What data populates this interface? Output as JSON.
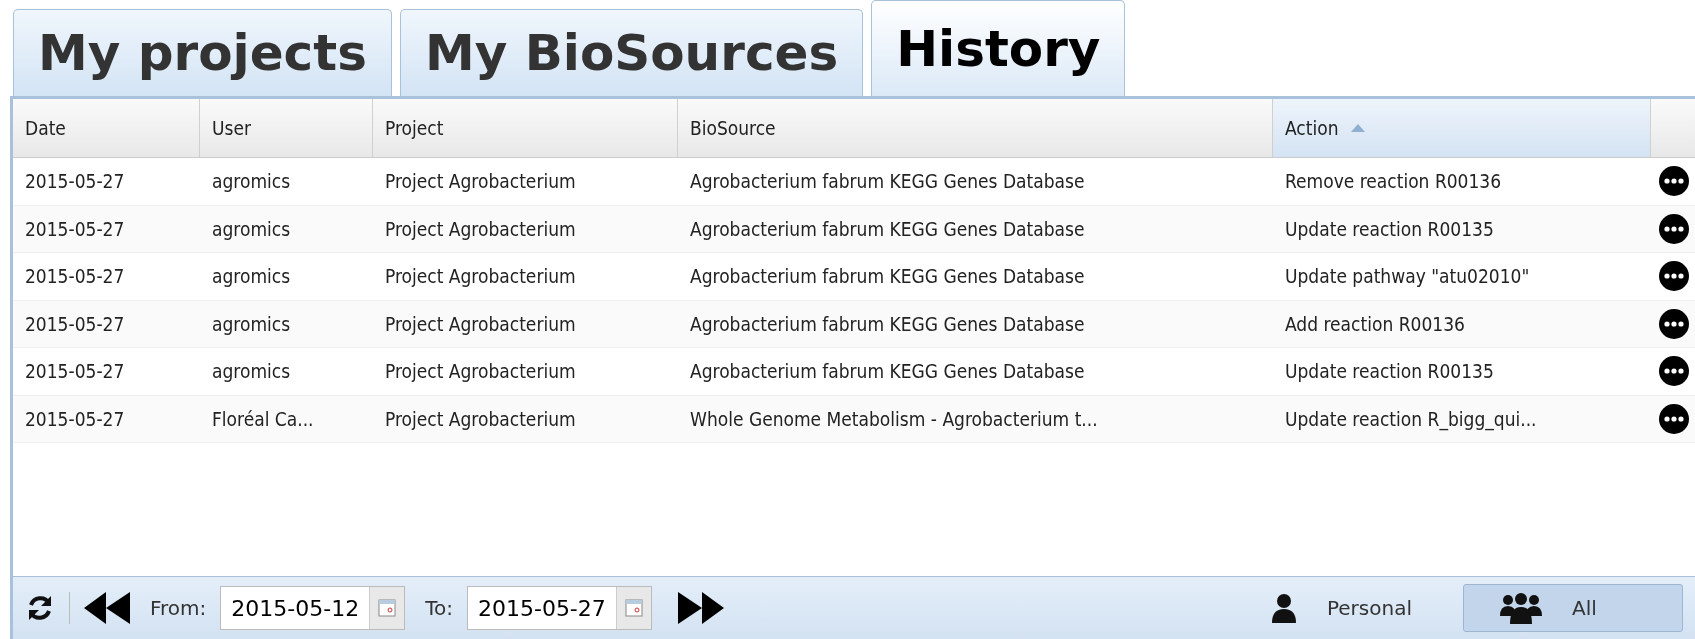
{
  "tabs": [
    {
      "label": "My projects",
      "selected": false
    },
    {
      "label": "My BioSources",
      "selected": false
    },
    {
      "label": "History",
      "selected": true
    }
  ],
  "table": {
    "columns": [
      {
        "label": "Date",
        "sorted": false
      },
      {
        "label": "User",
        "sorted": false
      },
      {
        "label": "Project",
        "sorted": false
      },
      {
        "label": "BioSource",
        "sorted": false
      },
      {
        "label": "Action",
        "sorted": true
      }
    ],
    "rows": [
      [
        "2015-05-27",
        "agromics",
        "Project Agrobacterium",
        "Agrobacterium fabrum KEGG Genes Database",
        "Remove reaction R00136"
      ],
      [
        "2015-05-27",
        "agromics",
        "Project Agrobacterium",
        "Agrobacterium fabrum KEGG Genes Database",
        "Update reaction R00135"
      ],
      [
        "2015-05-27",
        "agromics",
        "Project Agrobacterium",
        "Agrobacterium fabrum KEGG Genes Database",
        "Update pathway \"atu02010\""
      ],
      [
        "2015-05-27",
        "agromics",
        "Project Agrobacterium",
        "Agrobacterium fabrum KEGG Genes Database",
        "Add reaction R00136"
      ],
      [
        "2015-05-27",
        "agromics",
        "Project Agrobacterium",
        "Agrobacterium fabrum KEGG Genes Database",
        "Update reaction R00135"
      ],
      [
        "2015-05-27",
        "Floréal Ca...",
        "Project Agrobacterium",
        "Whole Genome Metabolism - Agrobacterium t...",
        "Update reaction R_bigg_qui..."
      ]
    ]
  },
  "footer": {
    "from_label": "From:",
    "from_value": "2015-05-12",
    "to_label": "To:",
    "to_value": "2015-05-27",
    "filters": [
      {
        "label": "Personal",
        "kind": "person",
        "selected": false
      },
      {
        "label": "All",
        "kind": "group",
        "selected": true
      }
    ]
  }
}
